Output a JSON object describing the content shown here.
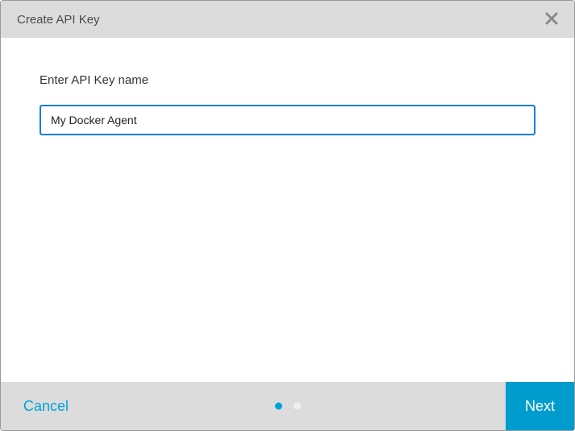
{
  "modal": {
    "title": "Create API Key",
    "body": {
      "label": "Enter API Key name",
      "input_value": "My Docker Agent"
    },
    "footer": {
      "cancel_label": "Cancel",
      "next_label": "Next",
      "step_current": 1,
      "step_total": 2
    }
  }
}
